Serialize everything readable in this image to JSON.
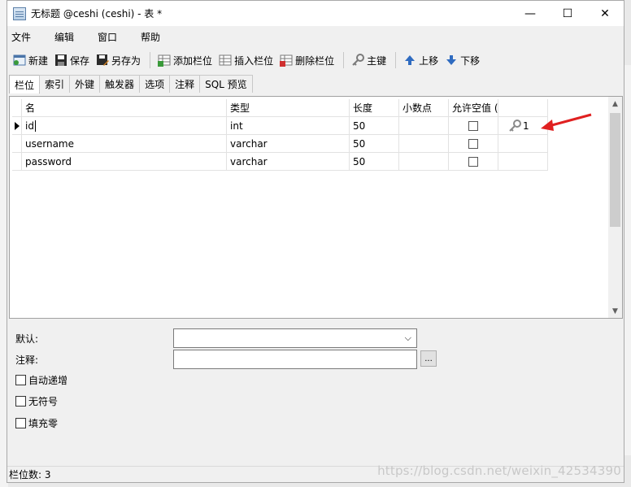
{
  "window": {
    "title": "无标题 @ceshi (ceshi) - 表 *",
    "minimize": "—",
    "maximize": "☐",
    "close": "✕"
  },
  "menu": [
    "文件",
    "编辑",
    "窗口",
    "帮助"
  ],
  "toolbar": {
    "new": "新建",
    "save": "保存",
    "save_as": "另存为",
    "add_field": "添加栏位",
    "insert_field": "插入栏位",
    "delete_field": "删除栏位",
    "primary_key": "主键",
    "move_up": "上移",
    "move_down": "下移"
  },
  "tabs": [
    "栏位",
    "索引",
    "外键",
    "触发器",
    "选项",
    "注释",
    "SQL 预览"
  ],
  "grid": {
    "headers": [
      "名",
      "类型",
      "长度",
      "小数点",
      "允许空值 (",
      ""
    ],
    "rows": [
      {
        "name": "id",
        "type": "int",
        "length": "50",
        "decimals": "",
        "nullable": false,
        "key": "1"
      },
      {
        "name": "username",
        "type": "varchar",
        "length": "50",
        "decimals": "",
        "nullable": false,
        "key": ""
      },
      {
        "name": "password",
        "type": "varchar",
        "length": "50",
        "decimals": "",
        "nullable": false,
        "key": ""
      }
    ]
  },
  "props": {
    "default_label": "默认:",
    "comment_label": "注释:",
    "dots": "...",
    "auto_increment": "自动递增",
    "unsigned": "无符号",
    "zerofill": "填充零"
  },
  "status": {
    "field_count": "栏位数: 3"
  },
  "watermark": "https://blog.csdn.net/weixin_42534390",
  "colors": {
    "arrow": "#e02020",
    "key_icon": "#8a8a8a"
  }
}
